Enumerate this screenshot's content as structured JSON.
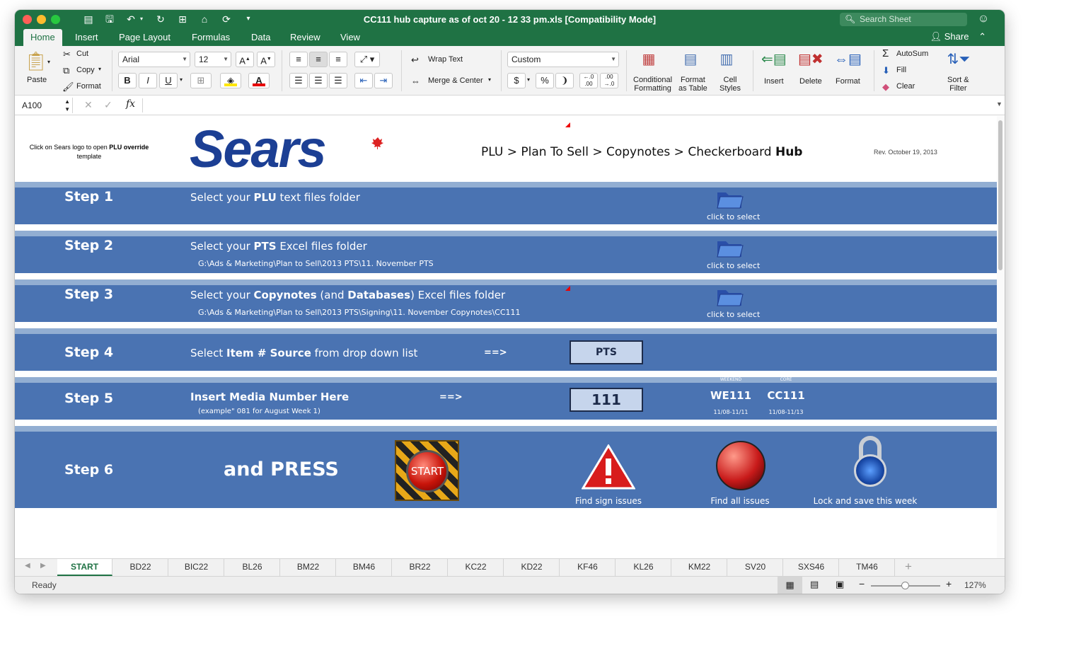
{
  "window": {
    "title": "CC111 hub capture as of oct 20 - 12 33 pm.xls  [Compatibility Mode]",
    "search_placeholder": "Search Sheet",
    "share_label": "Share"
  },
  "ribbon_tabs": [
    "Home",
    "Insert",
    "Page Layout",
    "Formulas",
    "Data",
    "Review",
    "View"
  ],
  "ribbon": {
    "paste": "Paste",
    "cut": "Cut",
    "copy": "Copy",
    "format": "Format",
    "font_name": "Arial",
    "font_size": "12",
    "wrap_text": "Wrap Text",
    "merge_center": "Merge & Center",
    "number_format": "Custom",
    "conditional": "Conditional",
    "formatting": "Formatting",
    "format_as": "Format",
    "as_table": "as Table",
    "cell": "Cell",
    "styles": "Styles",
    "insert": "Insert",
    "delete": "Delete",
    "format_cells": "Format",
    "autosum": "AutoSum",
    "fill": "Fill",
    "clear": "Clear",
    "sort": "Sort &",
    "filter": "Filter",
    "bold": "B",
    "italic": "I",
    "underline": "U",
    "dollar": "$",
    "percent": "%"
  },
  "formula_bar": {
    "name_box": "A100",
    "fx": "fx",
    "content": ""
  },
  "sheet": {
    "note_line1": "Click on Sears logo to open",
    "note_bold": "PLU override",
    "note_line2": "template",
    "logo_text": "Sears",
    "header_title": "PLU > Plan To Sell > Copynotes > Checkerboard",
    "header_bold": "Hub",
    "revision": "Rev. October 19, 2013",
    "steps": [
      {
        "label": "Step 1",
        "pre": "Select your ",
        "bold": "PLU",
        "post": " text files folder",
        "path": "",
        "action": "click to select"
      },
      {
        "label": "Step 2",
        "pre": "Select your ",
        "bold": "PTS",
        "post": " Excel files folder",
        "path": "G:\\Ads & Marketing\\Plan to Sell\\2013 PTS\\11. November PTS",
        "action": "click to select"
      },
      {
        "label": "Step 3",
        "pre": "Select your ",
        "bold": "Copynotes",
        "mid": " (and ",
        "bold2": "Databases",
        "post": ") Excel files folder",
        "path": "G:\\Ads & Marketing\\Plan to Sell\\2013 PTS\\Signing\\11. November Copynotes\\CC111",
        "action": "click to select"
      },
      {
        "label": "Step 4",
        "pre": "Select ",
        "bold": "Item # Source",
        "post": " from drop down list",
        "arrow": "==>",
        "value": "PTS"
      },
      {
        "label": "Step 5",
        "bold": "Insert Media Number Here",
        "example": "(example\" 081 for August Week 1)",
        "arrow": "==>",
        "value": "111",
        "weekend_label": "WEEKEND",
        "weekend_code": "WE111",
        "weekend_dates": "11/08-11/11",
        "core_label": "CORE",
        "core_code": "CC111",
        "core_dates": "11/08-11/13"
      },
      {
        "label": "Step 6",
        "press": "and PRESS",
        "start": "START",
        "find_sign": "Find sign issues",
        "find_all": "Find all issues",
        "lock": "Lock and save this week"
      }
    ]
  },
  "sheet_tabs": [
    "START",
    "BD22",
    "BIC22",
    "BL26",
    "BM22",
    "BM46",
    "BR22",
    "KC22",
    "KD22",
    "KF46",
    "KL26",
    "KM22",
    "SV20",
    "SXS46",
    "TM46"
  ],
  "status": {
    "ready": "Ready",
    "zoom": "127%",
    "zoom_level": 0.5
  },
  "colors": {
    "excel_green": "#1f7244",
    "band_blue": "#4a73b2",
    "sears_blue": "#1c3f94"
  }
}
